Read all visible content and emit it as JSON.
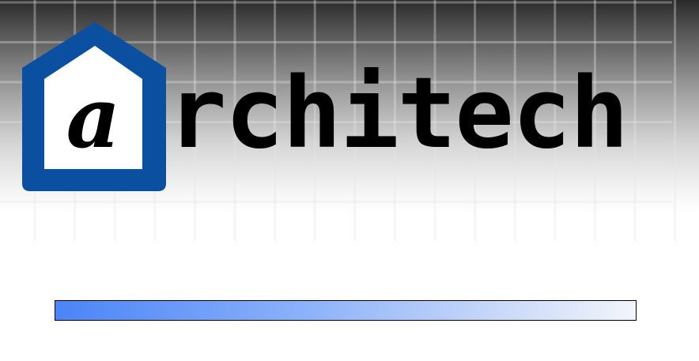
{
  "logo": {
    "letter": "a",
    "wordmark": "rchitech",
    "frame_color": "#0b4fa0"
  },
  "progress": {
    "value": 1.0
  }
}
